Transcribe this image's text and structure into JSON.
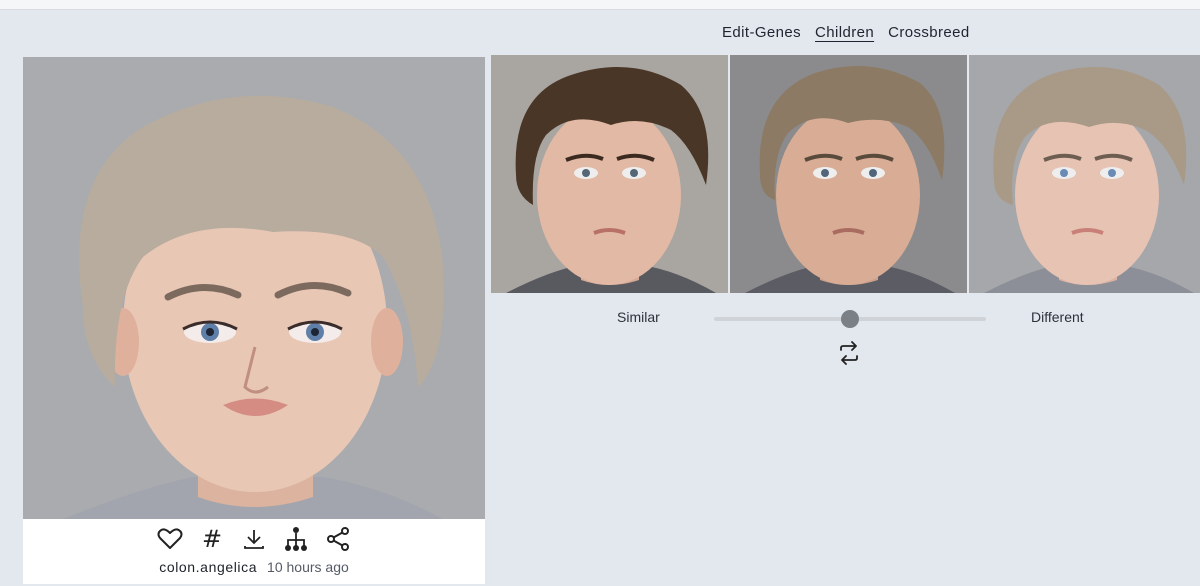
{
  "tabs": [
    {
      "label": "Edit-Genes",
      "active": false
    },
    {
      "label": "Children",
      "active": true
    },
    {
      "label": "Crossbreed",
      "active": false
    }
  ],
  "main_image": {
    "author": "colon.angelica",
    "time": "10 hours ago",
    "actions": [
      "heart-icon",
      "hashtag-icon",
      "download-icon",
      "family-tree-icon",
      "share-icon"
    ],
    "hair_color": "#b7ac9e",
    "skin_color": "#e9c7b5",
    "background_color": "#a9abaf"
  },
  "children": [
    {
      "hair_color": "#4a3626",
      "skin_color": "#e2b9a4",
      "background_color": "#a9a6a2"
    },
    {
      "hair_color": "#8c7a64",
      "skin_color": "#d9ad95",
      "background_color": "#8b8b8d"
    },
    {
      "hair_color": "#a89a86",
      "skin_color": "#e7c3b3",
      "background_color": "#a5a7ab"
    }
  ],
  "slider": {
    "min_label": "Similar",
    "max_label": "Different",
    "value": 0.5
  },
  "regenerate_icon": "repeat-icon"
}
